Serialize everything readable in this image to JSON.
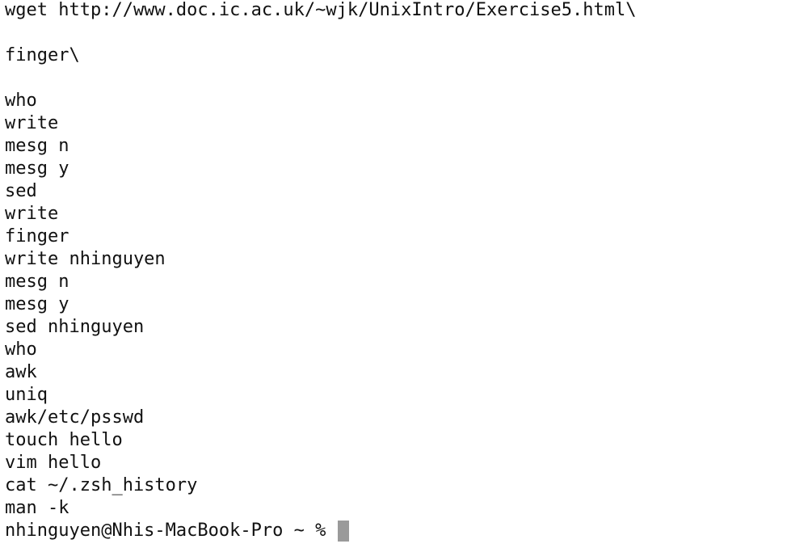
{
  "terminal": {
    "history_lines": [
      "wget http://www.doc.ic.ac.uk/~wjk/UnixIntro/Exercise5.html\\",
      "",
      "finger\\",
      "",
      "who",
      "write",
      "mesg n",
      "mesg y",
      "sed",
      "write",
      "finger",
      "write nhinguyen",
      "mesg n",
      "mesg y",
      "sed nhinguyen",
      "who",
      "awk",
      "uniq",
      "awk/etc/psswd",
      "touch hello",
      "vim hello",
      "cat ~/.zsh_history",
      "man -k"
    ],
    "prompt": "nhinguyen@Nhis-MacBook-Pro ~ % ",
    "colors": {
      "background": "#ffffff",
      "text": "#111111",
      "cursor": "#9a9a9a"
    }
  }
}
